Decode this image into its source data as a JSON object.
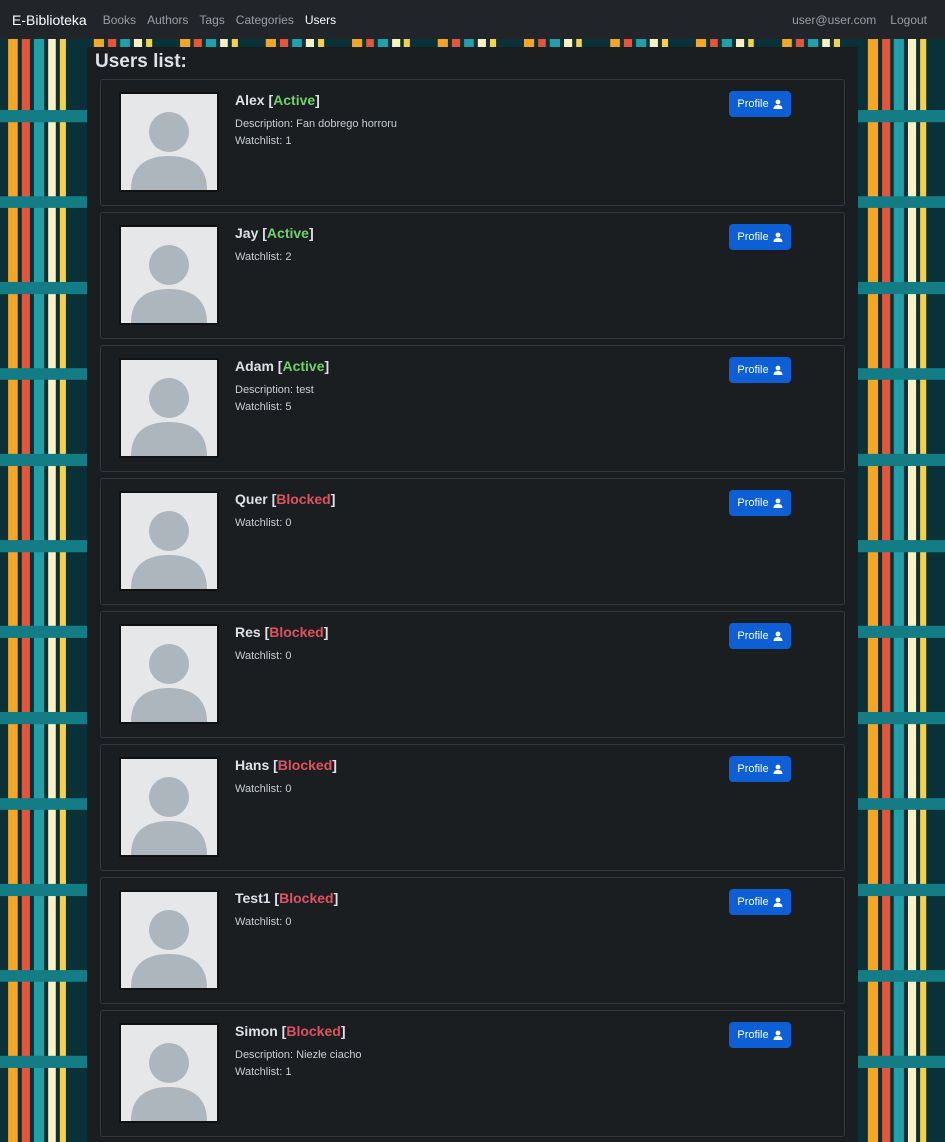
{
  "nav": {
    "brand": "E-Biblioteka",
    "links": [
      "Books",
      "Authors",
      "Tags",
      "Categories",
      "Users"
    ],
    "user_email": "user@user.com",
    "logout": "Logout"
  },
  "page": {
    "title": "Users list:"
  },
  "profile_label": "Profile",
  "colors": {
    "active": "#6fd36b",
    "blocked": "#e05260",
    "primary_button": "#0d5fd6",
    "navbar": "#212529"
  },
  "users": [
    {
      "name": "Alex",
      "status": "Active",
      "description": "Description: Fan dobrego horroru",
      "watchlist": "Watchlist: 1"
    },
    {
      "name": "Jay",
      "status": "Active",
      "description": "",
      "watchlist": "Watchlist: 2"
    },
    {
      "name": "Adam",
      "status": "Active",
      "description": "Description: test",
      "watchlist": "Watchlist: 5"
    },
    {
      "name": "Quer",
      "status": "Blocked",
      "description": "",
      "watchlist": "Watchlist: 0"
    },
    {
      "name": "Res",
      "status": "Blocked",
      "description": "",
      "watchlist": "Watchlist: 0"
    },
    {
      "name": "Hans",
      "status": "Blocked",
      "description": "",
      "watchlist": "Watchlist: 0"
    },
    {
      "name": "Test1",
      "status": "Blocked",
      "description": "",
      "watchlist": "Watchlist: 0"
    },
    {
      "name": "Simon",
      "status": "Blocked",
      "description": "Description: Niezłe ciacho",
      "watchlist": "Watchlist: 1"
    }
  ]
}
